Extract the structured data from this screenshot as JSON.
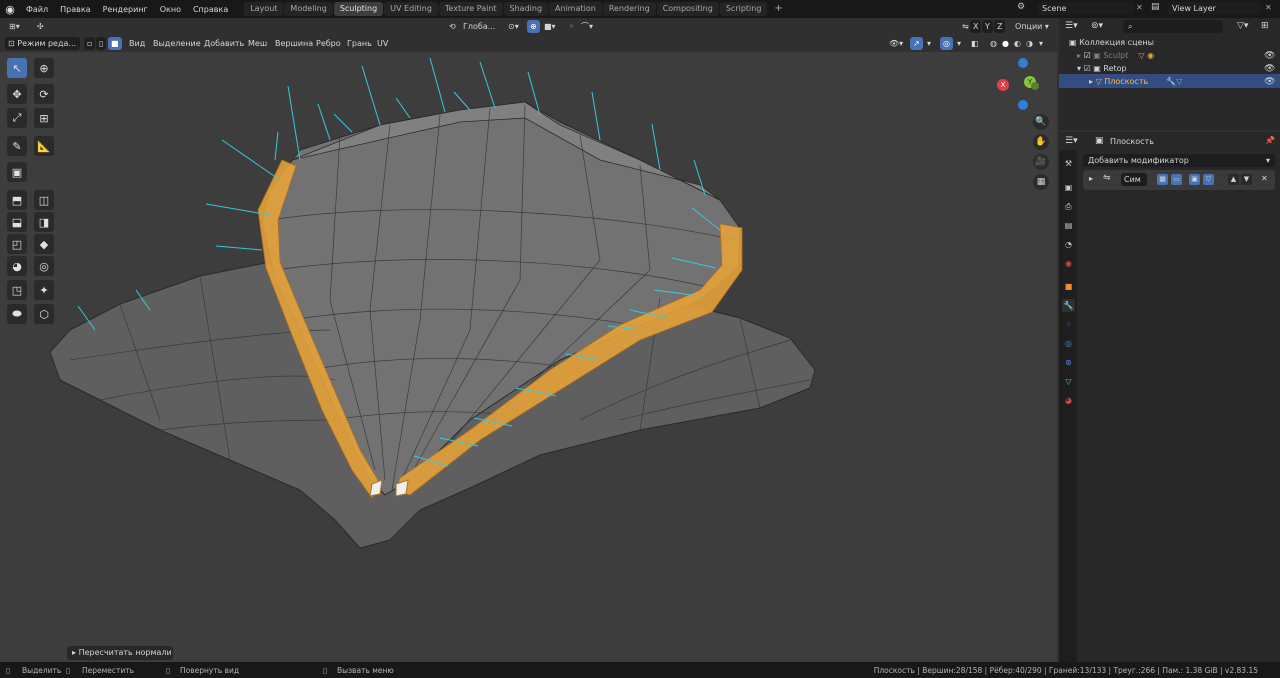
{
  "topbar": {
    "menus": [
      "Файл",
      "Правка",
      "Рендеринг",
      "Окно",
      "Справка"
    ],
    "workspaces": [
      "Layout",
      "Modeling",
      "Sculpting",
      "UV Editing",
      "Texture Paint",
      "Shading",
      "Animation",
      "Rendering",
      "Compositing",
      "Scripting"
    ],
    "active_workspace": "Sculpting",
    "add_tab": "+",
    "scene": "Scene",
    "view_layer": "View Layer"
  },
  "viewport_header": {
    "orientation": "Глоба...",
    "xyz": [
      "X",
      "Y",
      "Z"
    ],
    "options": "Опции",
    "mode": "Режим реда...",
    "menus": [
      "Вид",
      "Выделение",
      "Добавить",
      "Меш",
      "Вершина",
      "Ребро",
      "Грань",
      "UV"
    ]
  },
  "gizmo": {
    "x": "X",
    "y": "Y",
    "z": "Z"
  },
  "operator_panel": "Пересчитать нормали",
  "outliner": {
    "collection": "Коллекция сцены",
    "items": [
      {
        "name": "Sculpt",
        "disabled": true
      },
      {
        "name": "Retop",
        "disabled": false
      },
      {
        "name": "Плоскость",
        "selected": true
      }
    ],
    "search_placeholder": ""
  },
  "properties": {
    "object_name": "Плоскость",
    "add_modifier": "Добавить модификатор",
    "modifier_name": "Сим"
  },
  "statusbar": {
    "select": "Выделить",
    "move": "Переместить",
    "rotate": "Повернуть вид",
    "menu": "Вызвать меню",
    "stats": "Плоскость | Вершин:28/158 | Рёбер:40/290 | Граней:13/133 | Треуг.:266 | Пам.: 1.38 GiB | v2.83.15"
  },
  "colors": {
    "selection_orange": "#e8a43a",
    "normals_cyan": "#38c8e0",
    "mesh_gray": "#6e6e6e",
    "active_blue": "#4772b3"
  }
}
